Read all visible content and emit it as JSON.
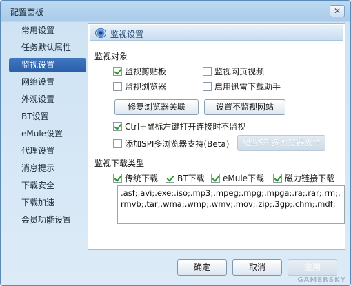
{
  "window": {
    "title": "配置面板",
    "close_glyph": "✕"
  },
  "sidebar": {
    "active_index": 2,
    "items": [
      {
        "label": "常用设置"
      },
      {
        "label": "任务默认属性"
      },
      {
        "label": "监视设置"
      },
      {
        "label": "网络设置"
      },
      {
        "label": "外观设置"
      },
      {
        "label": "BT设置"
      },
      {
        "label": "eMule设置"
      },
      {
        "label": "代理设置"
      },
      {
        "label": "消息提示"
      },
      {
        "label": "下载安全"
      },
      {
        "label": "下载加速"
      },
      {
        "label": "会员功能设置"
      }
    ]
  },
  "panel": {
    "header_title": "监视设置",
    "header_icon": "eye-icon",
    "monitor_objects": {
      "title": "监视对象",
      "clipboard": {
        "label": "监视剪贴板",
        "checked": true
      },
      "webpage_video": {
        "label": "监视网页视频",
        "checked": false
      },
      "browser": {
        "label": "监视浏览器",
        "checked": false
      },
      "xunlei_helper": {
        "label": "启用迅雷下载助手",
        "checked": false
      },
      "repair_button": "修复浏览器关联",
      "no_monitor_sites_button": "设置不监视网站",
      "ctrl_click": {
        "label": "Ctrl+鼠标左键打开连接时不监视",
        "checked": true
      },
      "spi": {
        "label": "添加SPI多浏览器支持(Beta)",
        "checked": false
      },
      "spi_button": "配置SPI多浏览器支持"
    },
    "monitor_types": {
      "title": "监视下载类型",
      "traditional": {
        "label": "传统下载",
        "checked": true
      },
      "bt": {
        "label": "BT下载",
        "checked": true
      },
      "emule": {
        "label": "eMule下载",
        "checked": true
      },
      "magnet": {
        "label": "磁力链接下载",
        "checked": true
      },
      "extensions": ".asf;.avi;.exe;.iso;.mp3;.mpeg;.mpg;.mpga;.ra;.rar;.rm;.rmvb;.tar;.wma;.wmp;.wmv;.mov;.zip;.3gp;.chm;.mdf;"
    }
  },
  "footer": {
    "ok": "确定",
    "cancel": "取消",
    "apply": "应用"
  },
  "watermark": "GAMERSKY",
  "colors": {
    "accent": "#2a5ea8",
    "check": "#2d9a2d",
    "window_bg": "#dcebf7"
  }
}
